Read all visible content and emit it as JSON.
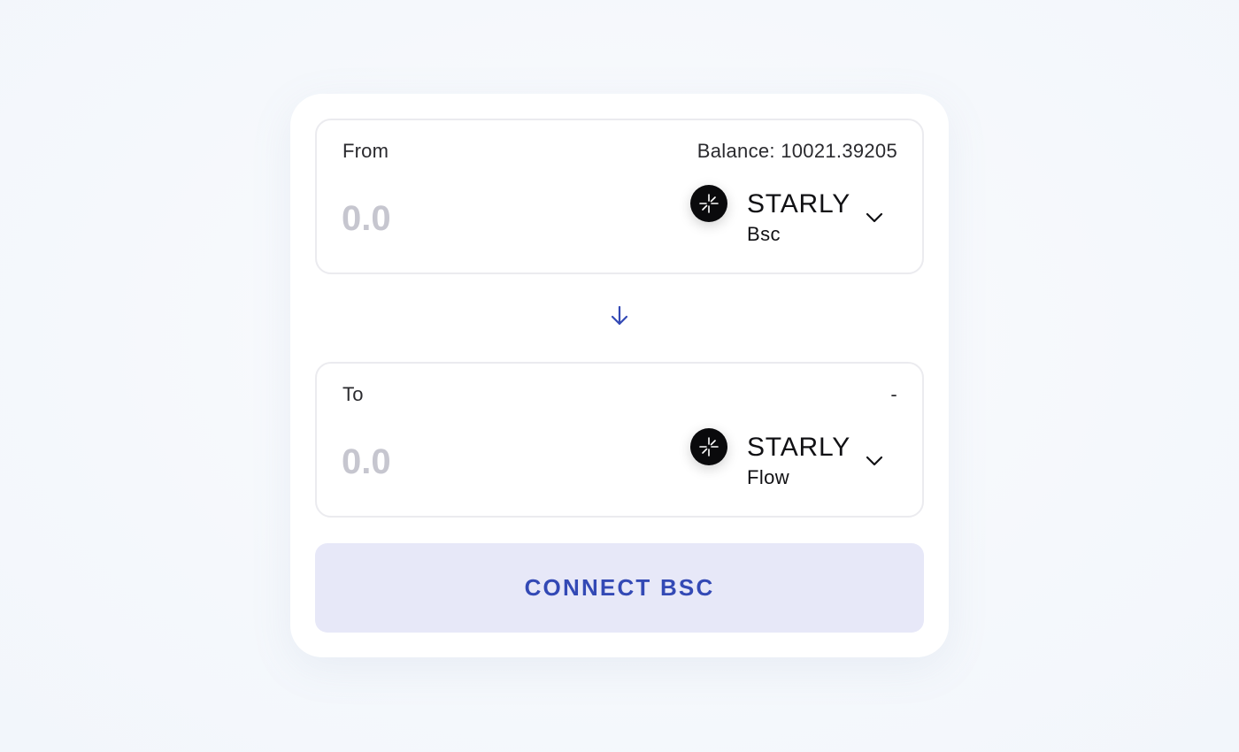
{
  "from": {
    "label": "From",
    "balance_text": "Balance: 10021.39205",
    "amount_placeholder": "0.0",
    "token": {
      "symbol": "STARLY",
      "network": "Bsc",
      "icon": "starly-logo-icon"
    }
  },
  "swap": {
    "icon": "arrow-down-icon",
    "color": "#3349b5"
  },
  "to": {
    "label": "To",
    "info_text": "-",
    "amount_placeholder": "0.0",
    "token": {
      "symbol": "STARLY",
      "network": "Flow",
      "icon": "starly-logo-icon"
    }
  },
  "connect_button": {
    "label": "CONNECT BSC",
    "background": "#e7e8f8",
    "text_color": "#3349b5"
  }
}
